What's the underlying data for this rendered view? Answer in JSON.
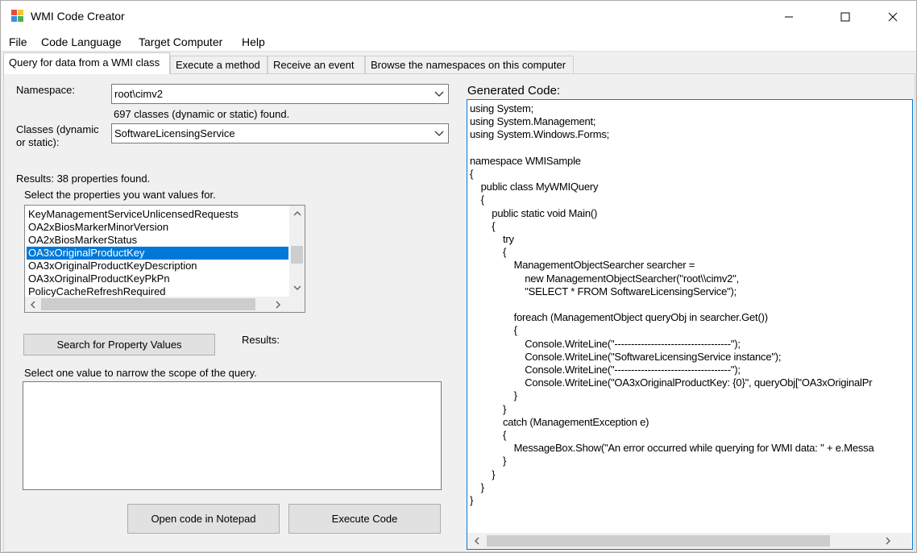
{
  "window": {
    "title": "WMI Code Creator"
  },
  "menu": {
    "items": [
      "File",
      "Code Language",
      "Target Computer",
      "Help"
    ]
  },
  "tabs": [
    "Query for data from a WMI class",
    "Execute a method",
    "Receive an event",
    "Browse the namespaces on this computer"
  ],
  "query": {
    "namespace_label": "Namespace:",
    "namespace_value": "root\\cimv2",
    "classes_found": "697 classes (dynamic or static) found.",
    "classes_label_line1": "Classes (dynamic",
    "classes_label_line2": "or static):",
    "class_value": "SoftwareLicensingService",
    "results_summary": "Results:  38 properties found.",
    "select_properties_label": "Select the properties you want values for.",
    "properties": [
      "KeyManagementServiceUnlicensedRequests",
      "OA2xBiosMarkerMinorVersion",
      "OA2xBiosMarkerStatus",
      "OA3xOriginalProductKey",
      "OA3xOriginalProductKeyDescription",
      "OA3xOriginalProductKeyPkPn",
      "PolicyCacheRefreshRequired"
    ],
    "selected_property": "OA3xOriginalProductKey",
    "search_button": "Search for Property Values",
    "results_label": "Results:",
    "narrow_scope_label": "Select one value to narrow the scope of the query.",
    "open_notepad_button": "Open code in Notepad",
    "execute_button": "Execute Code"
  },
  "generated": {
    "label": "Generated Code:",
    "code": "using System;\nusing System.Management;\nusing System.Windows.Forms;\n\nnamespace WMISample\n{\n    public class MyWMIQuery\n    {\n        public static void Main()\n        {\n            try\n            {\n                ManagementObjectSearcher searcher =\n                    new ManagementObjectSearcher(\"root\\\\cimv2\",\n                    \"SELECT * FROM SoftwareLicensingService\");\n\n                foreach (ManagementObject queryObj in searcher.Get())\n                {\n                    Console.WriteLine(\"-----------------------------------\");\n                    Console.WriteLine(\"SoftwareLicensingService instance\");\n                    Console.WriteLine(\"-----------------------------------\");\n                    Console.WriteLine(\"OA3xOriginalProductKey: {0}\", queryObj[\"OA3xOriginalPr\n                }\n            }\n            catch (ManagementException e)\n            {\n                MessageBox.Show(\"An error occurred while querying for WMI data: \" + e.Messa\n            }\n        }\n    }\n}"
  },
  "colors": {
    "selection": "#0078d7",
    "window_bg": "#f0f0f0",
    "focus_border": "#0078d7"
  }
}
